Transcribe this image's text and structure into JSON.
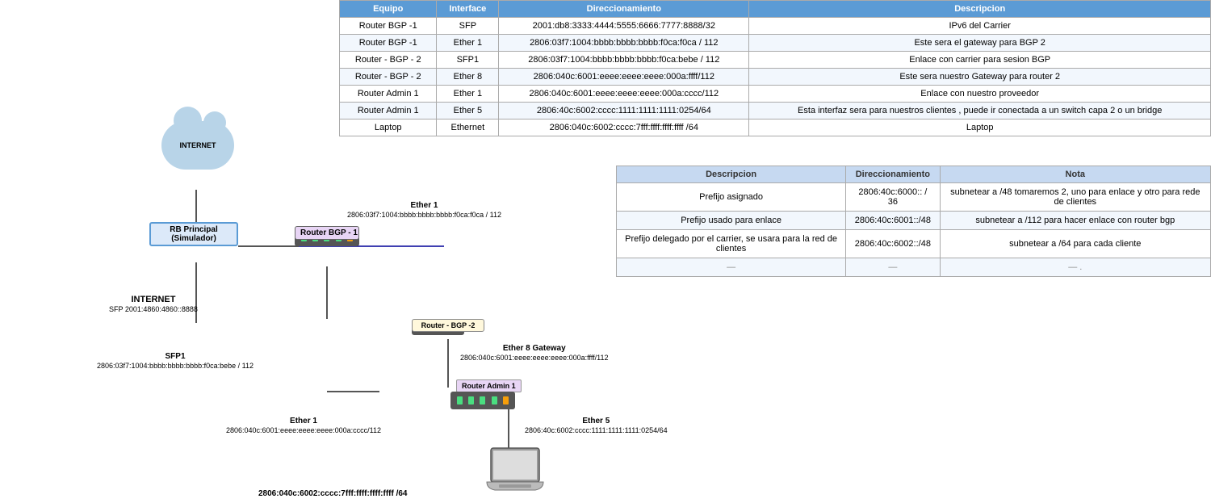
{
  "table": {
    "headers": [
      "Equipo",
      "Interface",
      "Direccionamiento",
      "Descripcion"
    ],
    "rows": [
      {
        "equipo": "Router BGP -1",
        "interface": "SFP",
        "direccionamiento": "2001:db8:3333:4444:5555:6666:7777:8888/32",
        "descripcion": "IPv6 del Carrier"
      },
      {
        "equipo": "Router BGP -1",
        "interface": "Ether 1",
        "direccionamiento": "2806:03f7:1004:bbbb:bbbb:bbbb:f0ca:f0ca / 112",
        "descripcion": "Este sera el gateway para BGP 2"
      },
      {
        "equipo": "Router - BGP - 2",
        "interface": "SFP1",
        "direccionamiento": "2806:03f7:1004:bbbb:bbbb:bbbb:f0ca:bebe / 112",
        "descripcion": "Enlace con carrier para sesion BGP"
      },
      {
        "equipo": "Router - BGP - 2",
        "interface": "Ether 8",
        "direccionamiento": "2806:040c:6001:eeee:eeee:eeee:000a:ffff/112",
        "descripcion": "Este sera nuestro Gateway para router 2"
      },
      {
        "equipo": "Router Admin 1",
        "interface": "Ether 1",
        "direccionamiento": "2806:040c:6001:eeee:eeee:eeee:000a:cccc/112",
        "descripcion": "Enlace con nuestro proveedor"
      },
      {
        "equipo": "Router Admin 1",
        "interface": "Ether 5",
        "direccionamiento": "2806:40c:6002:cccc:1111:1111:1111:0254/64",
        "descripcion": "Esta interfaz sera para nuestros clientes , puede ir conectada a un switch capa 2 o un bridge"
      },
      {
        "equipo": "Laptop",
        "interface": "Ethernet",
        "direccionamiento": "2806:040c:6002:cccc:7fff:ffff:ffff:ffff /64",
        "descripcion": "Laptop"
      }
    ]
  },
  "second_table": {
    "headers": [
      "Descripcion",
      "Direccionamiento",
      "Nota"
    ],
    "rows": [
      {
        "descripcion": "Prefijo asignado",
        "direccionamiento": "2806:40c:6000:: / 36",
        "nota": "subnetear a /48  tomaremos 2, uno para enlace y otro para rede de clientes"
      },
      {
        "descripcion": "Prefijo usado para enlace",
        "direccionamiento": "2806:40c:6001::/48",
        "nota": "subnetear a /112 para hacer enlace con router bgp"
      },
      {
        "descripcion": "Prefijo delegado por el carrier, se usara para la red de clientes",
        "direccionamiento": "2806:40c:6002::/48",
        "nota": "subnetear a /64 para cada cliente"
      },
      {
        "descripcion": "—",
        "direccionamiento": "—",
        "nota": "—  ."
      }
    ]
  },
  "diagram": {
    "internet_label": "INTERNET",
    "rb_principal_label": "RB Principal\n(Simulador)",
    "router_bgp1_label": "Router BGP -\n1",
    "router_bgp2_label": "Router - BGP -2",
    "router_admin1_label": "Router Admin 1",
    "internet_sfp_label": "INTERNET\nSFP 2001:4860:4860::8888",
    "ether1_bgp1_label": "Ether 1\n2806:03f7:1004:bbbb:bbbb:bbbb:f0ca:f0ca / 112",
    "sfp1_label": "SFP1\n2806:03f7:1004:bbbb:bbbb:bbbb:f0ca:bebe / 112",
    "ether8_label": "Ether 8 Gateway\n2806:040c:6001:eeee:eeee:eeee:000a:ffff/112",
    "ether1_admin_label": "Ether 1\n2806:040c:6001:eeee:eeee:eeee:000a:cccc/112",
    "ether5_label": "Ether 5\n2806:40c:6002:cccc:1111:1111:1111:0254/64",
    "laptop_addr_label": "2806:040c:6002:cccc:7fff:ffff:ffff:ffff /64"
  }
}
